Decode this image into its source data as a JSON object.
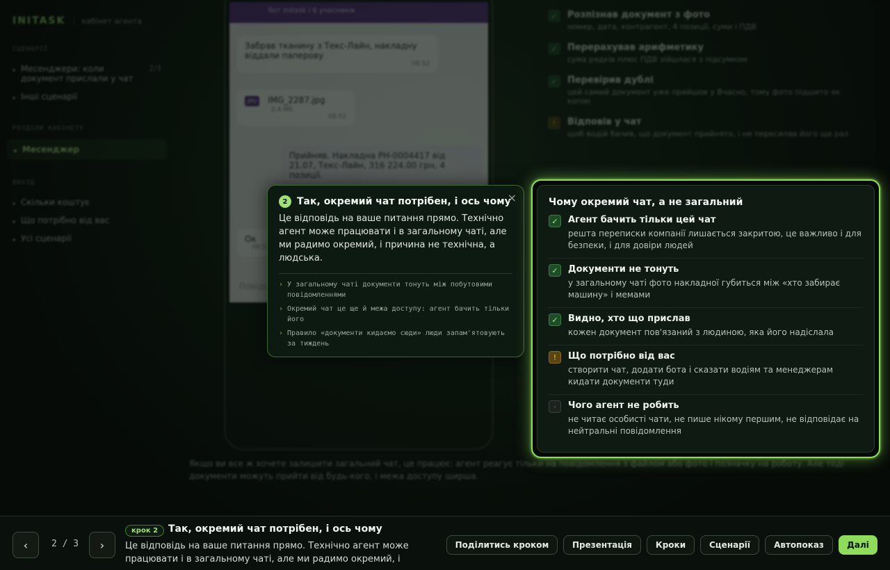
{
  "brand": {
    "logo": "INITASK",
    "subtitle": "кабінет агента"
  },
  "sidebar": {
    "sections": [
      {
        "title": "СЦЕНАРІЇ",
        "items": [
          {
            "label": "Месенджери: коли документ прислали у чат",
            "count": "2/3"
          },
          {
            "label": "Інші сценарії"
          }
        ]
      },
      {
        "title": "РОЗДІЛИ КАБІНЕТУ",
        "items": [
          {
            "label": "Месенджер",
            "active": true
          }
        ]
      },
      {
        "title": "ВИХІД",
        "items": [
          {
            "label": "Скільки коштує"
          },
          {
            "label": "Що потрібно від вас"
          },
          {
            "label": "Усі сценарії"
          }
        ]
      }
    ]
  },
  "phone": {
    "header_subtitle": "бот Initask і 6 учасників",
    "messages": [
      {
        "text": "Забрав тканину з Текс-Лайн, накладну віддали паперову",
        "time": "08:52"
      },
      {
        "file": "IMG_2287.jpg",
        "size": "2,4 Мб",
        "tag": "JPG",
        "time": "08:52"
      },
      {
        "text": "Прийняв. Накладна РН-0004417 від 21.07, Текс-Лайн, 316 224.00 грн, 4 позиції."
      },
      {
        "text": "Ок",
        "time": "08:55"
      }
    ],
    "input_placeholder": "Повідомлення"
  },
  "right_list": [
    {
      "icon": "check-icon",
      "title": "Розпізнав документ з фото",
      "desc": "номер, дата, контрагент, 4 позиції, суми і ПДВ"
    },
    {
      "icon": "check-icon",
      "title": "Перерахував арифметику",
      "desc": "сума рядків плюс ПДВ зійшлася з підсумком"
    },
    {
      "icon": "check-icon",
      "title": "Перевірив дублі",
      "desc": "цей самий документ уже прийшов у Вчасно, тому фото підшито як копію"
    },
    {
      "icon": "warning-icon",
      "title": "Відповів у чат",
      "desc": "щоб водій бачив, що документ прийнято, і не пересилав його ще раз"
    }
  ],
  "bottom_note": "Якщо ви все ж хочете залишити загальний чат, це працює: агент реагує тільки на повідомлення з файлом або фото і позначку на роботу. Але тоді документи можуть прийти від будь-кого, і межа доступу ширша.",
  "popover": {
    "step": "2",
    "title": "Так, окремий чат потрібен, і ось чому",
    "body": "Це відповідь на ваше питання прямо. Технічно агент може працювати і в загальному чаті, але ми радимо окремий, і причина не технічна, а людська.",
    "bullets": [
      "У загальному чаті документи тонуть між побутовими повідомленнями",
      "Окремий чат це ще й межа доступу: агент бачить тільки його",
      "Правило «документи кидаємо сюди» люди запам'ятовують за тиждень"
    ],
    "close": "×"
  },
  "highlight_panel": {
    "title": "Чому окремий чат, а не загальний",
    "items": [
      {
        "kind": "ok",
        "icon": "check-icon",
        "glyph": "✓",
        "title": "Агент бачить тільки цей чат",
        "desc": "решта переписки компанії лишається закритою, це важливо і для безпеки, і для довіри людей"
      },
      {
        "kind": "ok",
        "icon": "check-icon",
        "glyph": "✓",
        "title": "Документи не тонуть",
        "desc": "у загальному чаті фото накладної губиться між «хто забирає машину» і мемами"
      },
      {
        "kind": "ok",
        "icon": "check-icon",
        "glyph": "✓",
        "title": "Видно, хто що прислав",
        "desc": "кожен документ пов'язаний з людиною, яка його надіслала"
      },
      {
        "kind": "warn",
        "icon": "warning-icon",
        "glyph": "!",
        "title": "Що потрібно від вас",
        "desc": "створити чат, додати бота і сказати водіям та менеджерам кидати документи туди"
      },
      {
        "kind": "neutral",
        "icon": "dot-icon",
        "glyph": "·",
        "title": "Чого агент не робить",
        "desc": "не читає особисті чати, не пише нікому першим, не відповідає на нейтральні повідомлення"
      }
    ]
  },
  "bottombar": {
    "prev": "‹",
    "next": "›",
    "counter": "2 / 3",
    "badge": "крок 2",
    "title": "Так, окремий чат потрібен, і ось чому",
    "desc": "Це відповідь на ваше питання прямо. Технічно агент може працювати і в загальному чаті, але ми радимо окремий, і причин…",
    "buttons": {
      "share": "Поділитись кроком",
      "presentation": "Презентація",
      "steps": "Кроки",
      "scenarios": "Сценарії",
      "autoshow": "Автопоказ",
      "next": "Далі"
    }
  }
}
